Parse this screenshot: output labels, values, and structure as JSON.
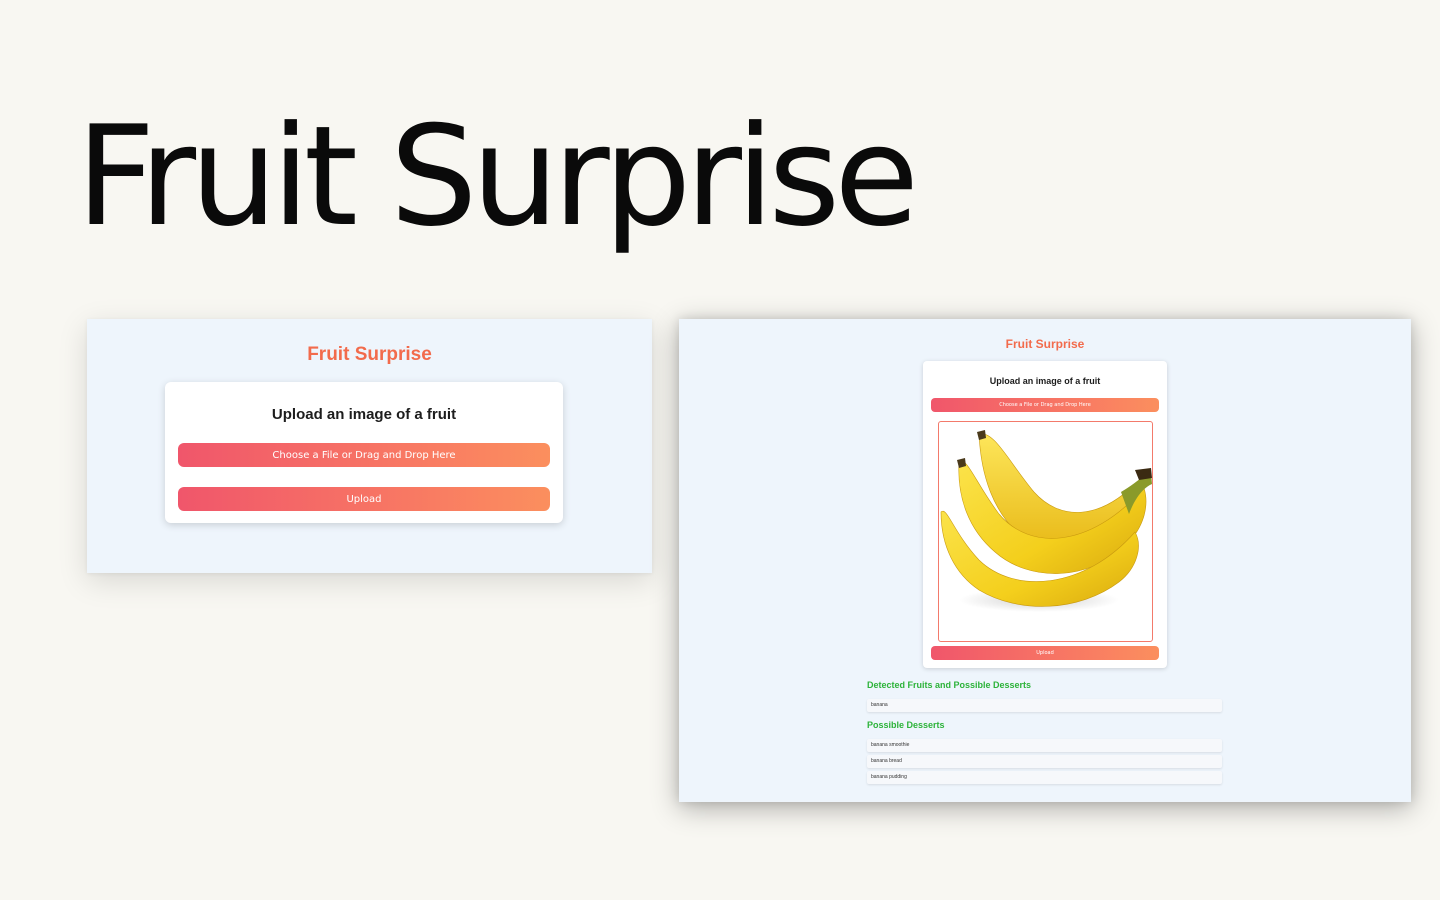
{
  "hero": {
    "title": "Fruit Surprise"
  },
  "left_screen": {
    "app_title": "Fruit Surprise",
    "card_title": "Upload an image of a fruit",
    "choose_label": "Choose a File or Drag and Drop Here",
    "upload_label": "Upload"
  },
  "right_screen": {
    "app_title": "Fruit Surprise",
    "card_title": "Upload an image of a fruit",
    "choose_label": "Choose a File or Drag and Drop Here",
    "upload_label": "Upload",
    "preview_image": "banana-photo",
    "detected_title": "Detected Fruits and Possible Desserts",
    "detected": [
      "banana"
    ],
    "desserts_title": "Possible Desserts",
    "desserts": [
      "banana smoothie",
      "banana bread",
      "banana pudding"
    ]
  },
  "colors": {
    "page_bg": "#f8f7f2",
    "screen_bg": "#eef5fc",
    "title_accent": "#f26b4c",
    "button_gradient_start": "#f0566b",
    "button_gradient_end": "#fb8f5e",
    "section_green": "#2db33a"
  }
}
